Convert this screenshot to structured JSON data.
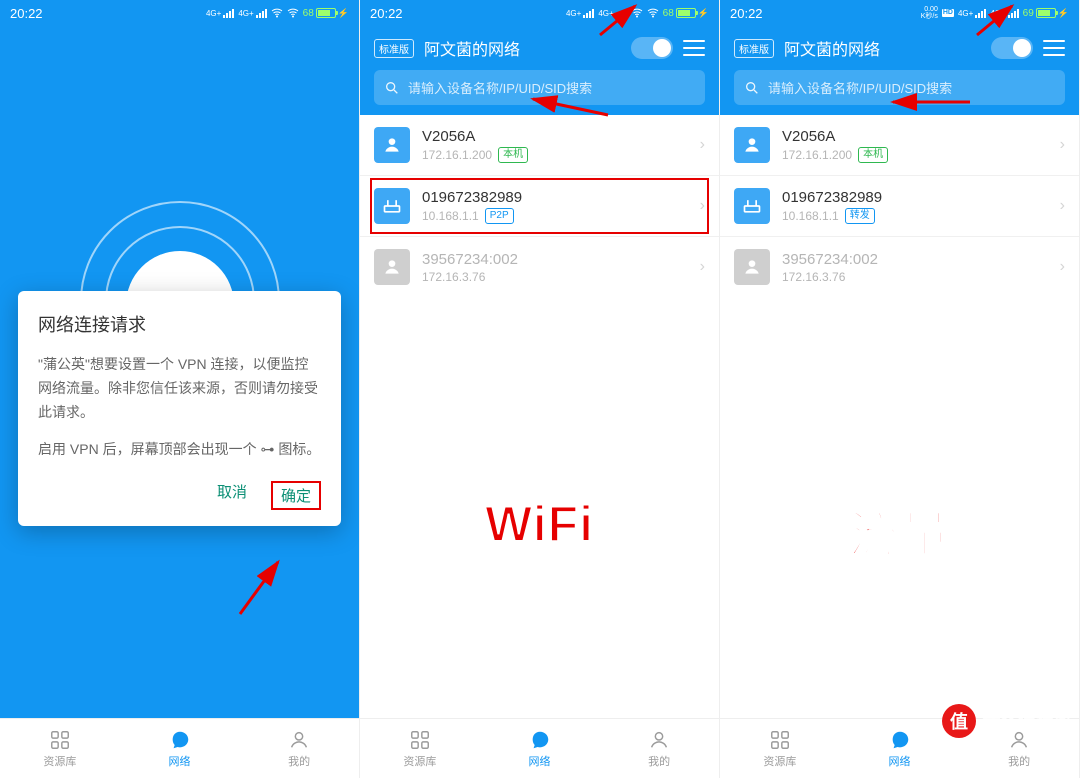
{
  "status": {
    "time": "20:22",
    "battery": "68",
    "battery3": "69",
    "net4g": "4G+",
    "hd": "HD",
    "kbs_top": "0.00",
    "kbs_bot": "K秒/s"
  },
  "header": {
    "badge": "标准版",
    "net_name": "阿文菌的网络"
  },
  "search": {
    "placeholder": "请输入设备名称/IP/UID/SID搜索"
  },
  "dialog": {
    "title": "网络连接请求",
    "l1a": "\"蒲公英\"想要设置一个 VPN 连接，以便监控网络流量。除非您信任该来源，否则请勿接受此请求。",
    "l2a": "启用 VPN 后，屏幕顶部会出现一个 ",
    "l2b": " 图标。",
    "cancel": "取消",
    "ok": "确定"
  },
  "devices": {
    "d1": {
      "name": "V2056A",
      "ip": "172.16.1.200",
      "tag": "本机"
    },
    "d2": {
      "name": "019672382989",
      "ip": "10.168.1.1",
      "tag_p2p": "P2P",
      "tag_relay": "转发"
    },
    "d3": {
      "name": "39567234:002",
      "ip": "172.16.3.76"
    }
  },
  "labels": {
    "wifi": "WiFi",
    "cellular": "流量"
  },
  "nav": {
    "library": "资源库",
    "network": "网络",
    "mine": "我的"
  },
  "watermark": {
    "char": "值",
    "text": "什么值得买"
  }
}
